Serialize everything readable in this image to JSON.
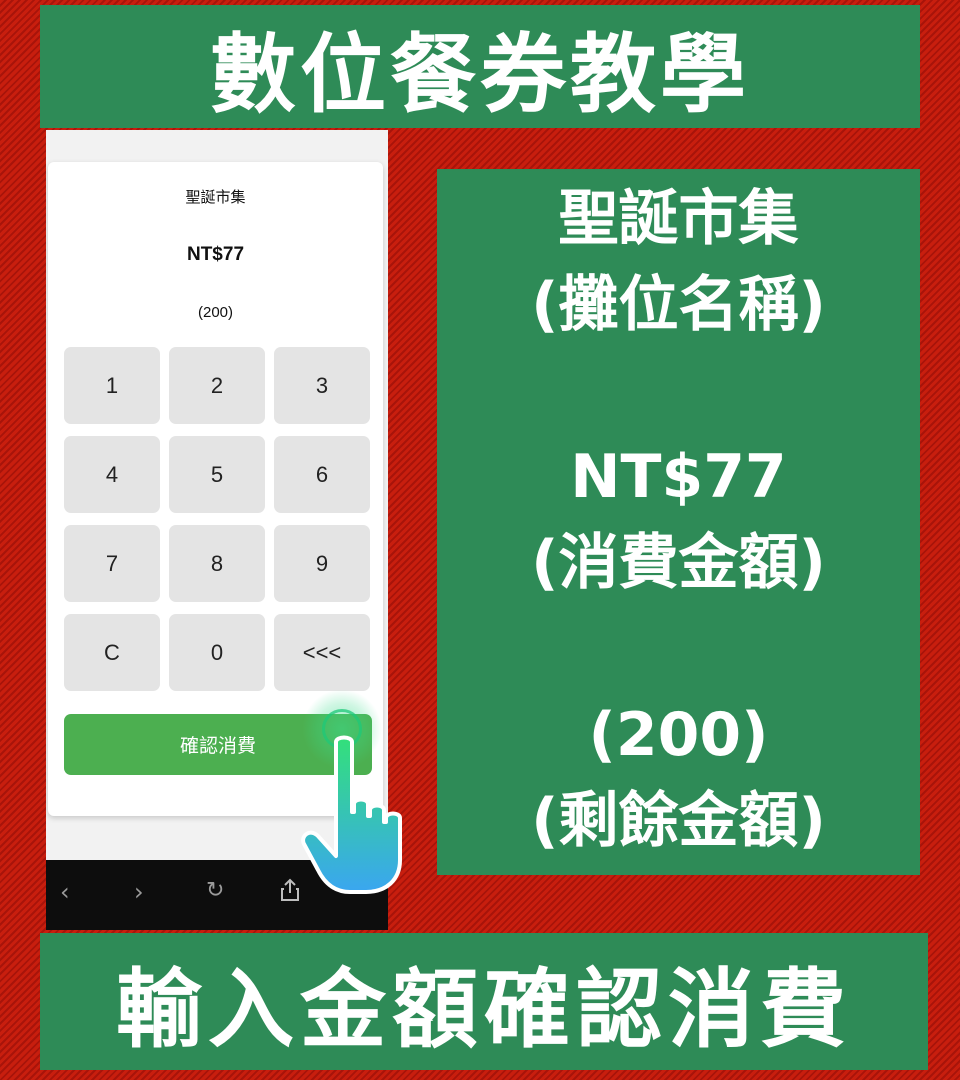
{
  "top_banner": {
    "title": "數位餐券教學"
  },
  "info_panel": {
    "stall_name": "聖誕市集",
    "stall_caption": "(攤位名稱)",
    "amount": "NT$77",
    "amount_caption": "(消費金額)",
    "balance": "(200)",
    "balance_caption": "(剩餘金額)"
  },
  "phone": {
    "stall_name": "聖誕市集",
    "amount": "NT$77",
    "balance": "(200)",
    "keypad": [
      "1",
      "2",
      "3",
      "4",
      "5",
      "6",
      "7",
      "8",
      "9",
      "C",
      "0",
      "<<<"
    ],
    "confirm_label": "確認消費",
    "browser_icons": [
      "back-icon",
      "forward-icon",
      "reload-icon",
      "share-icon"
    ]
  },
  "bottom_banner": {
    "title": "輸入金額確認消費"
  },
  "colors": {
    "panel_green": "#2e8b57",
    "confirm_green": "#4caf50",
    "background_red": "#c81e0e"
  }
}
